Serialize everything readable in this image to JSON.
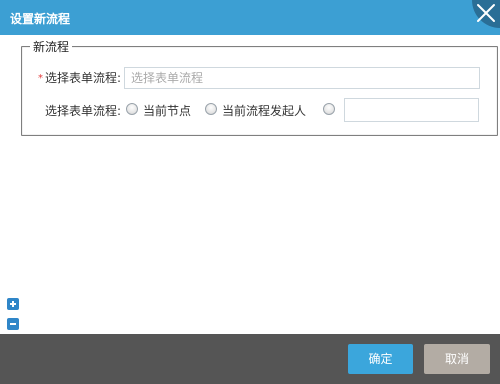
{
  "dialog": {
    "title": "设置新流程"
  },
  "form": {
    "legend": "新流程",
    "required_mark": "*",
    "field1_label": "选择表单流程:",
    "field1_placeholder": "选择表单流程",
    "field2_label": "选择表单流程:",
    "radio_options": [
      "当前节点",
      "当前流程发起人"
    ]
  },
  "footer": {
    "ok_label": "确定",
    "cancel_label": "取消"
  },
  "colors": {
    "titlebar": "#3c9fd3",
    "ok": "#3ba6dc",
    "cancel": "#b3aca4",
    "footer": "#555555"
  },
  "icons": [
    "close-icon",
    "plus-icon",
    "minus-icon"
  ]
}
